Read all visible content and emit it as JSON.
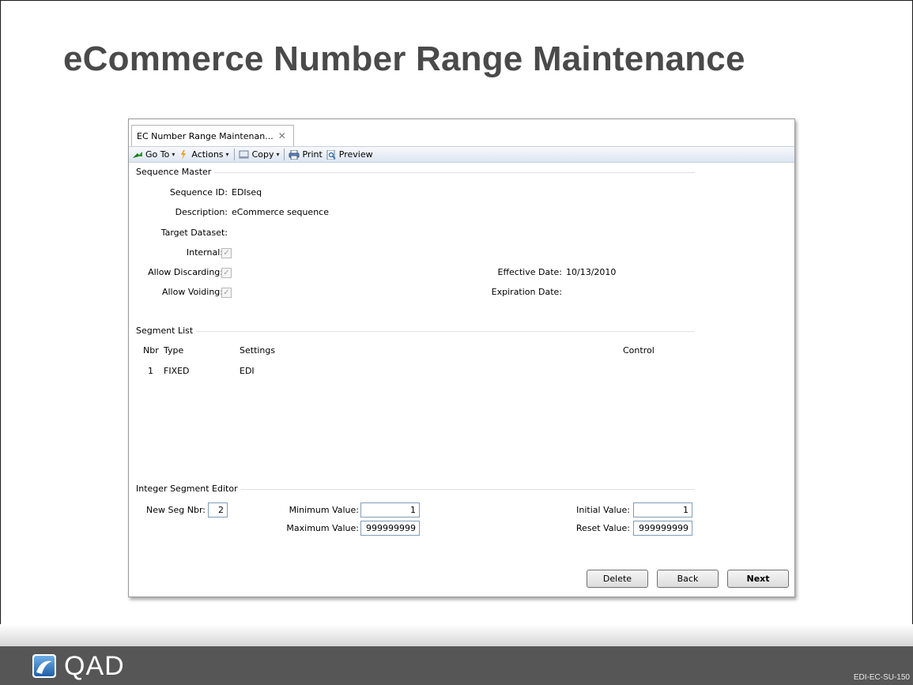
{
  "slide": {
    "title": "eCommerce Number Range Maintenance",
    "brand": "QAD",
    "code": "EDI-EC-SU-150"
  },
  "window": {
    "tab_label": "EC Number Range Maintenan...",
    "tab_close": "✕",
    "toolbar": {
      "goto": "Go To",
      "actions": "Actions",
      "copy": "Copy",
      "print": "Print",
      "preview": "Preview",
      "dropdown_arrow": "▾"
    }
  },
  "sequence_master": {
    "group_label": "Sequence Master",
    "sequence_id_label": "Sequence ID:",
    "sequence_id_value": "EDIseq",
    "description_label": "Description:",
    "description_value": "eCommerce sequence",
    "target_dataset_label": "Target Dataset:",
    "internal_label": "Internal:",
    "allow_discarding_label": "Allow Discarding:",
    "allow_voiding_label": "Allow Voiding:",
    "check_mark": "✓",
    "effective_date_label": "Effective Date:",
    "effective_date_value": "10/13/2010",
    "expiration_date_label": "Expiration Date:"
  },
  "segment_list": {
    "group_label": "Segment List",
    "columns": [
      "Nbr",
      "Type",
      "Settings",
      "Control"
    ],
    "rows": [
      {
        "nbr": "1",
        "type": "FIXED",
        "settings": "EDI",
        "control": ""
      }
    ]
  },
  "integer_segment_editor": {
    "group_label": "Integer Segment Editor",
    "new_seg_nbr_label": "New Seg Nbr:",
    "new_seg_nbr_value": "2",
    "minimum_value_label": "Minimum Value:",
    "minimum_value": "1",
    "maximum_value_label": "Maximum Value:",
    "maximum_value": "999999999",
    "initial_value_label": "Initial Value:",
    "initial_value": "1",
    "reset_value_label": "Reset Value:",
    "reset_value": "999999999"
  },
  "buttons": {
    "delete": "Delete",
    "back": "Back",
    "next": "Next"
  },
  "colors": {
    "title_gray": "#4a4a4a",
    "footer_gray": "#565656",
    "toolbar_blue": "#dde6f2"
  }
}
